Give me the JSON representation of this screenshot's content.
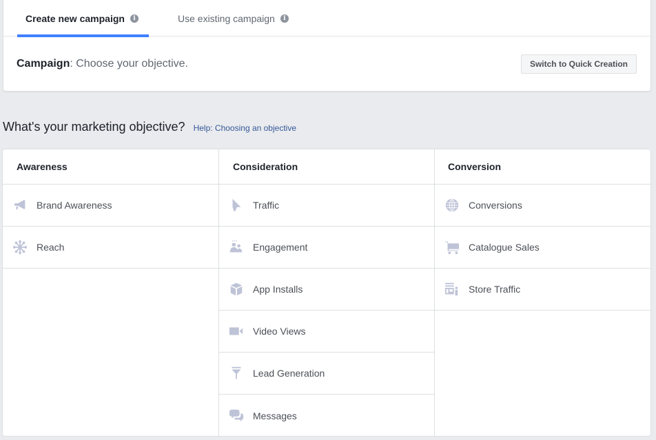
{
  "tabs": [
    {
      "label": "Create new campaign",
      "active": true,
      "info_icon": "info-icon"
    },
    {
      "label": "Use existing campaign",
      "active": false,
      "info_icon": "info-icon"
    }
  ],
  "campaign": {
    "label": "Campaign",
    "text": ": Choose your objective.",
    "quick_creation_button": "Switch to Quick Creation"
  },
  "objective": {
    "heading": "What's your marketing objective?",
    "help_link": "Help: Choosing an objective"
  },
  "accent_color": "#4080ff",
  "icon_color": "#bec3d7",
  "columns": [
    {
      "header": "Awareness",
      "items": [
        {
          "label": "Brand Awareness",
          "icon": "megaphone-icon"
        },
        {
          "label": "Reach",
          "icon": "reach-icon"
        }
      ]
    },
    {
      "header": "Consideration",
      "items": [
        {
          "label": "Traffic",
          "icon": "cursor-icon"
        },
        {
          "label": "Engagement",
          "icon": "people-icon"
        },
        {
          "label": "App Installs",
          "icon": "box-icon"
        },
        {
          "label": "Video Views",
          "icon": "video-camera-icon"
        },
        {
          "label": "Lead Generation",
          "icon": "funnel-icon"
        },
        {
          "label": "Messages",
          "icon": "chat-bubbles-icon"
        }
      ]
    },
    {
      "header": "Conversion",
      "items": [
        {
          "label": "Conversions",
          "icon": "globe-icon"
        },
        {
          "label": "Catalogue Sales",
          "icon": "shopping-cart-icon"
        },
        {
          "label": "Store Traffic",
          "icon": "store-icon"
        }
      ]
    }
  ]
}
